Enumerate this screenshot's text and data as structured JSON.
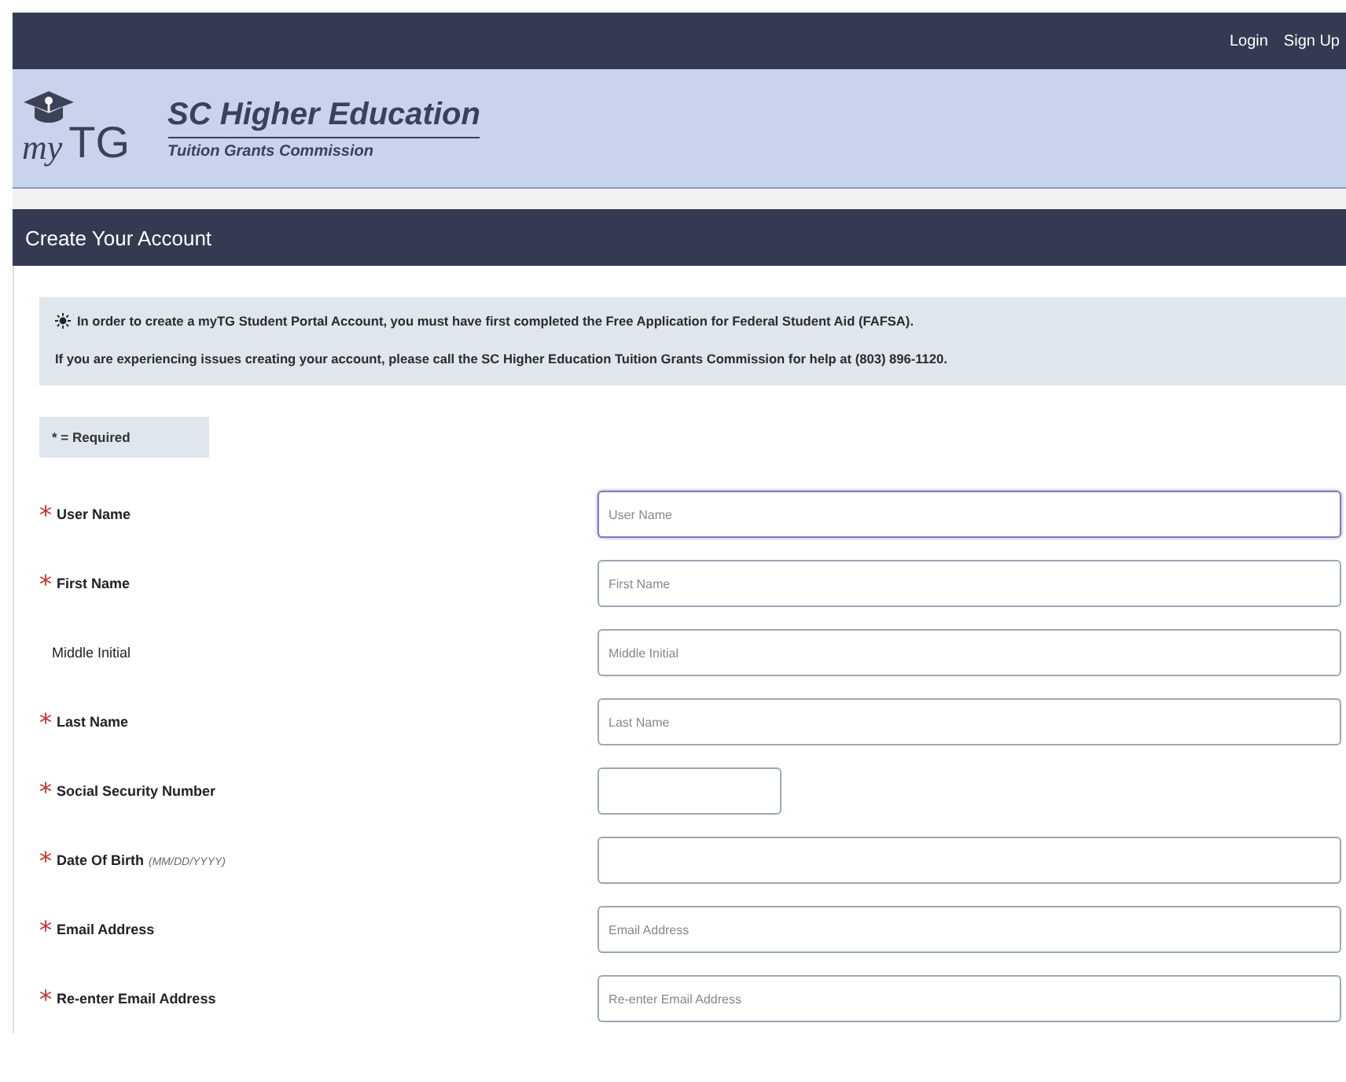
{
  "top_bar": {
    "links": [
      "Login",
      "Sign Up"
    ]
  },
  "header": {
    "logo_text": {
      "my": "my",
      "tg": "TG"
    },
    "title": "SC Higher Education",
    "subtitle": "Tuition Grants Commission"
  },
  "page_title": "Create Your Account",
  "notice": {
    "lines": [
      "In order to create a myTG Student Portal Account, you must have first completed the Free Application for Federal Student Aid (FAFSA).",
      "If you are experiencing issues creating your account, please call the SC Higher Education Tuition Grants Commission for help at (803) 896-1120."
    ]
  },
  "required_legend": "* = Required",
  "required_mark": "*",
  "fields": [
    {
      "label": "User Name",
      "required": true,
      "placeholder": "User Name",
      "kind": "wide",
      "focused": true
    },
    {
      "label": "First Name",
      "required": true,
      "placeholder": "First Name",
      "kind": "wide",
      "focused": false
    },
    {
      "label": "Middle Initial",
      "required": false,
      "placeholder": "Middle Initial",
      "kind": "wide",
      "focused": false
    },
    {
      "label": "Last Name",
      "required": true,
      "placeholder": "Last Name",
      "kind": "wide",
      "focused": false
    },
    {
      "label": "Social Security Number",
      "required": true,
      "kind": "short",
      "focused": false
    },
    {
      "label": "Date Of Birth",
      "required": true,
      "hint": "(MM/DD/YYYY)",
      "kind": "wide",
      "focused": false
    },
    {
      "label": "Email Address",
      "required": true,
      "placeholder": "Email Address",
      "kind": "wide",
      "focused": false
    },
    {
      "label": "Re-enter Email Address",
      "required": true,
      "placeholder": "Re-enter Email Address",
      "kind": "wide",
      "focused": false
    }
  ]
}
